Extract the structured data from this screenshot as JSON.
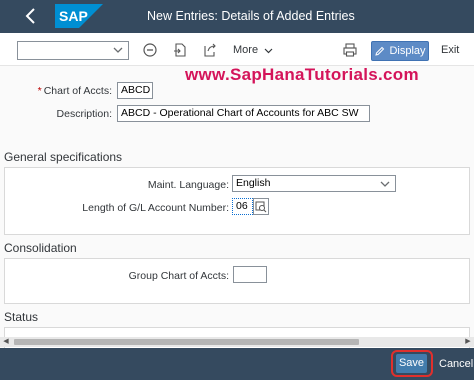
{
  "shell": {
    "title": "New Entries: Details of Added Entries",
    "logo_text": "SAP",
    "brand_color": "#354a5f",
    "logo_color": "#008fd3"
  },
  "toolbar": {
    "select_value": "",
    "more_label": "More",
    "display_label": "Display",
    "exit_label": "Exit",
    "icons": [
      "back-icon",
      "remove-icon",
      "export-icon",
      "share-icon",
      "print-icon",
      "edit-icon"
    ]
  },
  "watermark": "www.SapHanaTutorials.com",
  "form": {
    "chart_of_accts_label": "Chart of Accts:",
    "chart_of_accts_value": "ABCD",
    "description_label": "Description:",
    "description_value": "ABCD - Operational Chart of Accounts for ABC SW"
  },
  "general": {
    "title": "General specifications",
    "language_label": "Maint. Language:",
    "language_value": "English",
    "gl_length_label": "Length of G/L Account Number:",
    "gl_length_value": "06"
  },
  "consolidation": {
    "title": "Consolidation",
    "group_label": "Group Chart of Accts:",
    "group_value": ""
  },
  "status": {
    "title": "Status"
  },
  "footer": {
    "save_label": "Save",
    "cancel_label": "Cancel",
    "highlight_color": "#e0302d"
  }
}
